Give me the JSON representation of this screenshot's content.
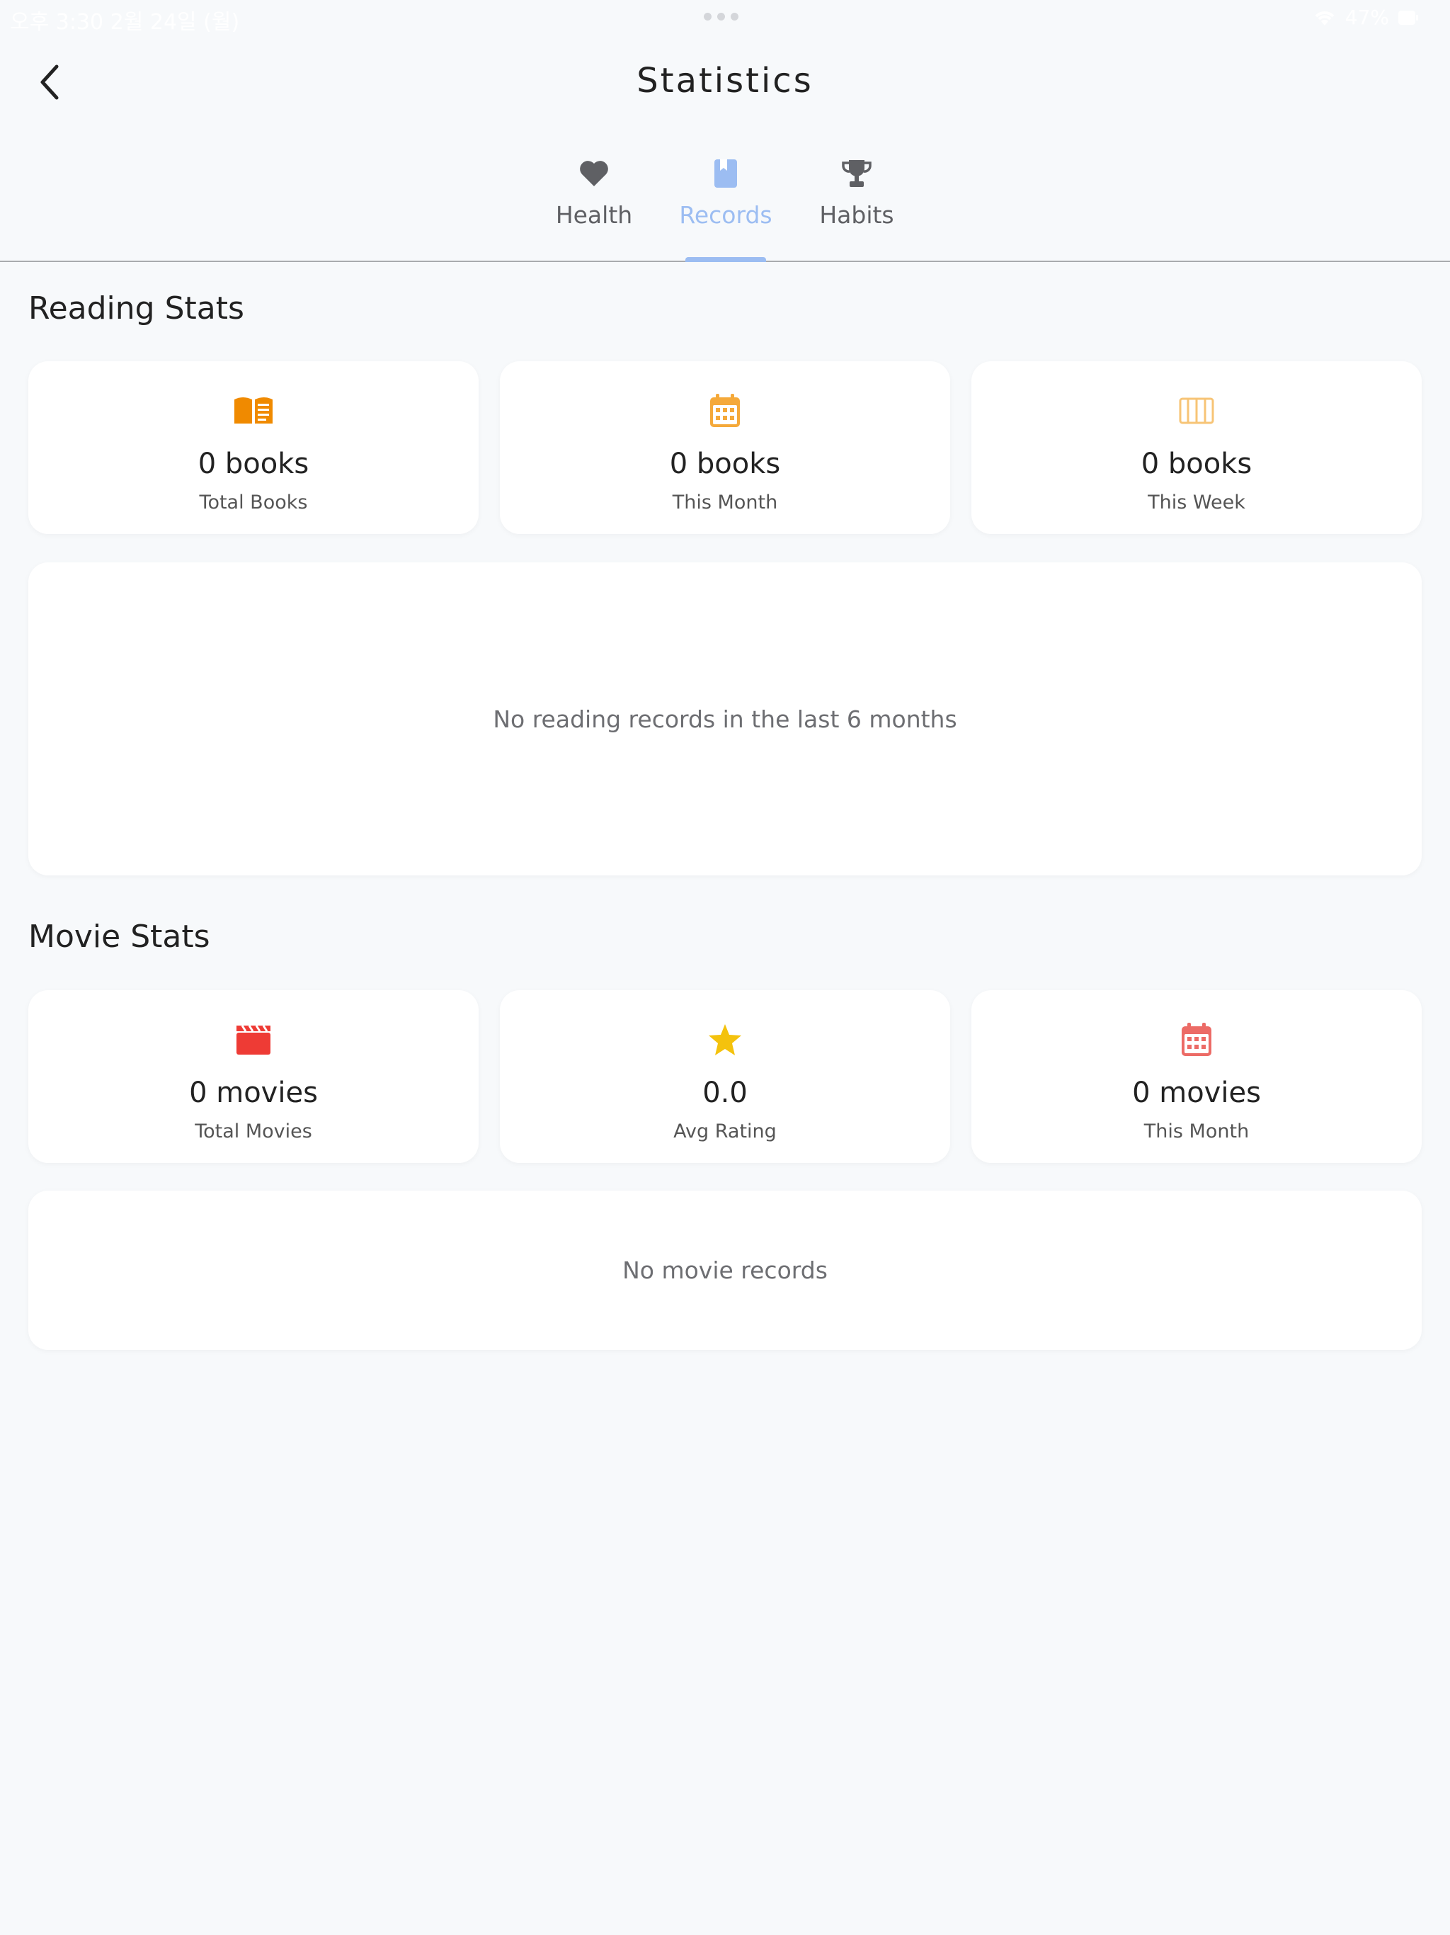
{
  "status_bar": {
    "time": "오후 3:30  2월 24일 (월)",
    "battery": "47%"
  },
  "header": {
    "title": "Statistics"
  },
  "tabs": [
    {
      "label": "Health",
      "icon": "heart-icon"
    },
    {
      "label": "Records",
      "icon": "book-icon"
    },
    {
      "label": "Habits",
      "icon": "trophy-icon"
    }
  ],
  "active_tab": "Records",
  "reading": {
    "title": "Reading Stats",
    "cards": [
      {
        "value": "0 books",
        "label": "Total Books",
        "icon": "open-book-icon",
        "color": "#f08a00"
      },
      {
        "value": "0 books",
        "label": "This Month",
        "icon": "calendar-icon",
        "color": "#f5a93a"
      },
      {
        "value": "0 books",
        "label": "This Week",
        "icon": "week-columns-icon",
        "color": "#f7c476"
      }
    ],
    "empty": "No reading records in the last 6 months"
  },
  "movies": {
    "title": "Movie Stats",
    "cards": [
      {
        "value": "0 movies",
        "label": "Total Movies",
        "icon": "clapperboard-icon",
        "color": "#ee3b35"
      },
      {
        "value": "0.0",
        "label": "Avg Rating",
        "icon": "star-icon",
        "color": "#f4c20d"
      },
      {
        "value": "0 movies",
        "label": "This Month",
        "icon": "calendar-icon",
        "color": "#ec6b66"
      }
    ],
    "empty": "No movie records"
  },
  "colors": {
    "accent": "#9cbdf2",
    "background": "#f7f9fb",
    "tab_inactive": "#5f6064"
  }
}
